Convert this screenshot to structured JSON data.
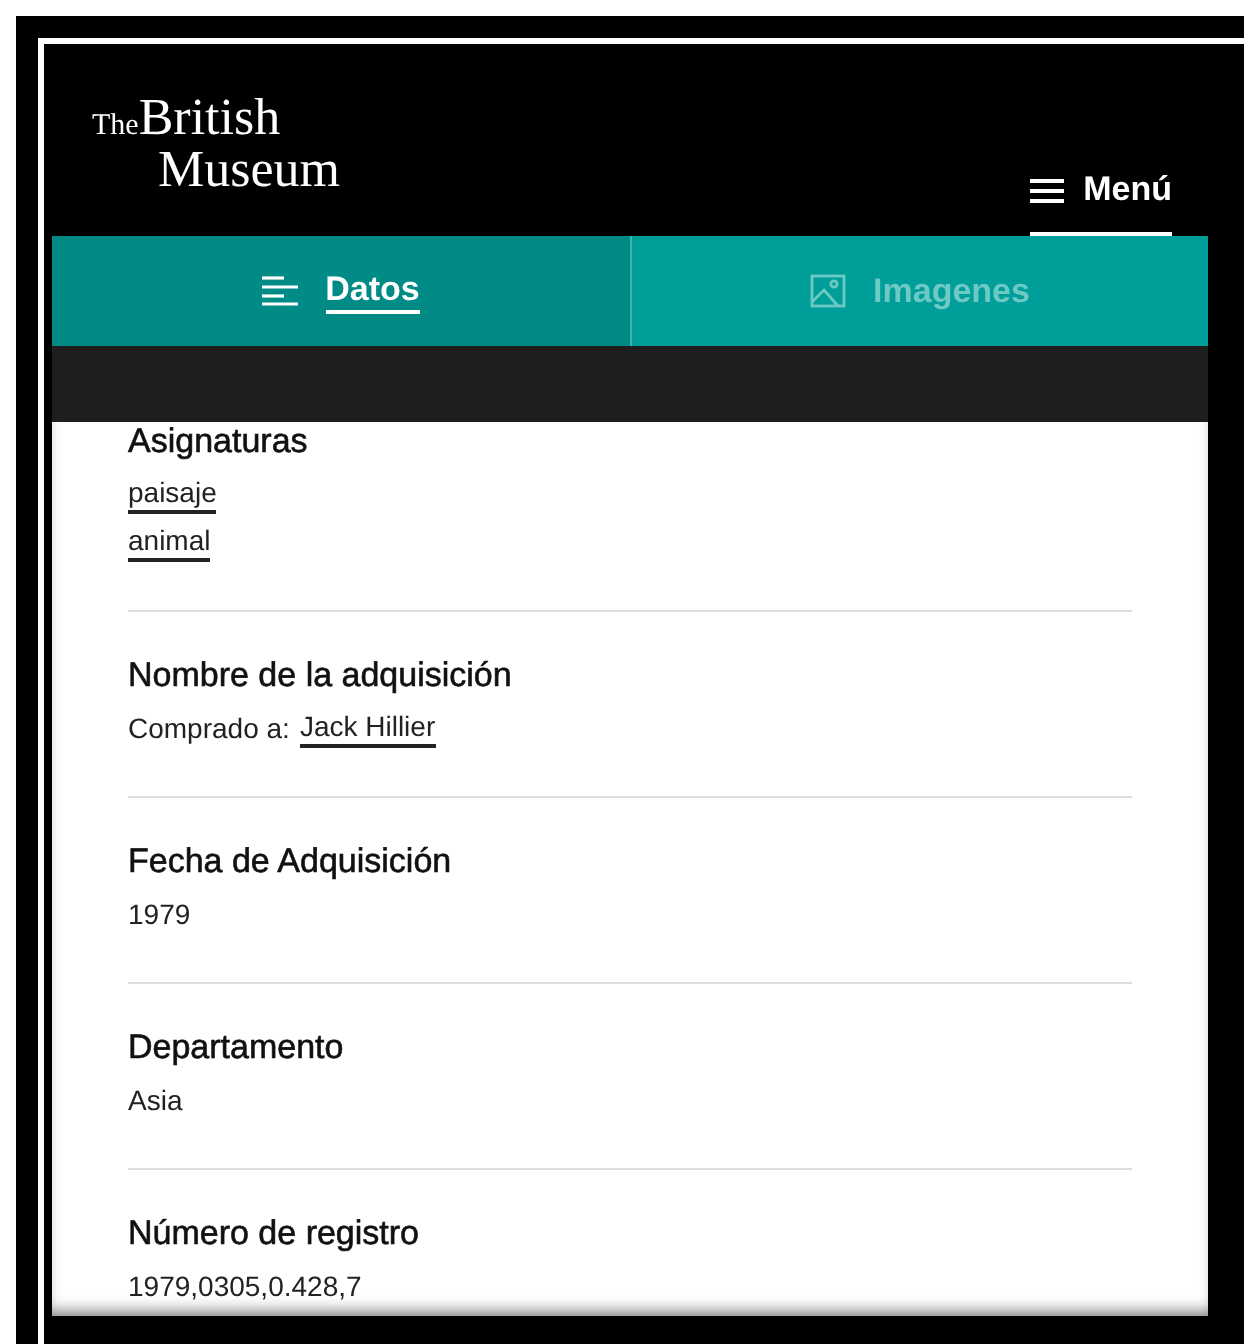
{
  "header": {
    "logo": {
      "small": "The",
      "line1": "British",
      "line2": "Museum"
    },
    "menu": "Menú"
  },
  "tabs": [
    {
      "label": "Datos",
      "kind": "list",
      "selected": true
    },
    {
      "label": "Imagenes",
      "kind": "image",
      "selected": false
    }
  ],
  "sections": [
    {
      "heading": "Asignaturas",
      "lines": [
        [
          {
            "kind": "link",
            "text": "paisaje"
          }
        ],
        [
          {
            "kind": "link",
            "text": "animal"
          }
        ]
      ]
    },
    {
      "heading": "Nombre de la adquisición",
      "lines": [
        [
          {
            "kind": "text",
            "text": "Comprado a:"
          },
          {
            "kind": "link",
            "text": "Jack Hillier"
          }
        ]
      ]
    },
    {
      "heading": "Fecha de Adquisición",
      "lines": [
        [
          {
            "kind": "text",
            "text": "1979"
          }
        ]
      ]
    },
    {
      "heading": "Departamento",
      "lines": [
        [
          {
            "kind": "text",
            "text": "Asia"
          }
        ]
      ]
    },
    {
      "heading": "Número de registro",
      "lines": [
        [
          {
            "kind": "text",
            "text": "1979,0305,0.428,7"
          }
        ]
      ]
    }
  ]
}
